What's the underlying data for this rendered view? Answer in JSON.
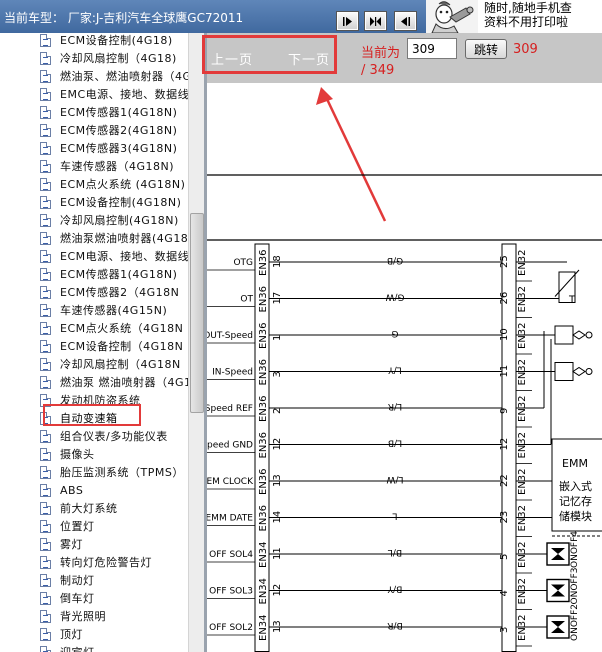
{
  "header": {
    "vehicle_label": "当前车型：  厂家:J-吉利汽车全球鹰GC72011",
    "promo_line1": "随时,随地手机查",
    "promo_line2": "资料不用打印啦"
  },
  "sidebar": {
    "items": [
      {
        "label": "ECM设备控制(4G18)",
        "selected": false
      },
      {
        "label": "冷却风扇控制（4G18)",
        "selected": false
      },
      {
        "label": "燃油泵、燃油喷射器（4G",
        "selected": false
      },
      {
        "label": "EMC电源、接地、数据线",
        "selected": false
      },
      {
        "label": "ECM传感器1(4G18N)",
        "selected": false
      },
      {
        "label": "ECM传感器2(4G18N)",
        "selected": false
      },
      {
        "label": "ECM传感器3(4G18N)",
        "selected": false
      },
      {
        "label": "车速传感器（4G18N)",
        "selected": false
      },
      {
        "label": "ECM点火系统 (4G18N)",
        "selected": false
      },
      {
        "label": "ECM设备控制(4G18N)",
        "selected": false
      },
      {
        "label": "冷却风扇控制(4G18N)",
        "selected": false
      },
      {
        "label": "燃油泵燃油喷射器(4G18N",
        "selected": false
      },
      {
        "label": "ECM电源、接地、数据线",
        "selected": false
      },
      {
        "label": "ECM传感器1(4G18N)",
        "selected": false
      },
      {
        "label": "ECM传感器2（4G18N",
        "selected": false
      },
      {
        "label": "车速传感器(4G15N)",
        "selected": false
      },
      {
        "label": "ECM点火系统（4G18N",
        "selected": false
      },
      {
        "label": "ECM设备控制（4G18N",
        "selected": false
      },
      {
        "label": "冷却风扇控制（4G18N",
        "selected": false
      },
      {
        "label": "燃油泵 燃油喷射器（4G1",
        "selected": false
      },
      {
        "label": "发动机防盗系统",
        "selected": false
      },
      {
        "label": "自动变速箱",
        "selected": true
      },
      {
        "label": "组合仪表/多功能仪表",
        "selected": false
      },
      {
        "label": "摄像头",
        "selected": false
      },
      {
        "label": "胎压监测系统（TPMS）",
        "selected": false
      },
      {
        "label": "ABS",
        "selected": false
      },
      {
        "label": "前大灯系统",
        "selected": false
      },
      {
        "label": "位置灯",
        "selected": false
      },
      {
        "label": "雾灯",
        "selected": false
      },
      {
        "label": "转向灯危险警告灯",
        "selected": false
      },
      {
        "label": "制动灯",
        "selected": false
      },
      {
        "label": "倒车灯",
        "selected": false
      },
      {
        "label": "背光照明",
        "selected": false
      },
      {
        "label": "顶灯",
        "selected": false
      },
      {
        "label": "迎宾灯",
        "selected": false
      }
    ]
  },
  "pager": {
    "prev_label": "上一页",
    "next_label": "下一页",
    "current_label": "当前为",
    "page_value": "309",
    "jump_label": "跳转",
    "page_current": "309",
    "page_total": "/ 349"
  },
  "diagram": {
    "rows": [
      {
        "pin_name": "OTG",
        "left_conn": "EN36",
        "left_pin": "18",
        "wire": "G/B",
        "right_pin": "25",
        "right_conn": "EN32"
      },
      {
        "pin_name": "OT",
        "left_conn": "EN36",
        "left_pin": "17",
        "wire": "G/W",
        "right_pin": "26",
        "right_conn": "EN32"
      },
      {
        "pin_name": "OUT-Speed",
        "left_conn": "EN36",
        "left_pin": "1",
        "wire": "G",
        "right_pin": "10",
        "right_conn": "EN32"
      },
      {
        "pin_name": "IN-Speed",
        "left_conn": "EN36",
        "left_pin": "3",
        "wire": "L/Y",
        "right_pin": "11",
        "right_conn": "EN32"
      },
      {
        "pin_name": "Speed REF",
        "left_conn": "EN36",
        "left_pin": "2",
        "wire": "L/R",
        "right_pin": "9",
        "right_conn": "EN32"
      },
      {
        "pin_name": "Speed GND",
        "left_conn": "EN36",
        "left_pin": "12",
        "wire": "L/B",
        "right_pin": "12",
        "right_conn": "EN32"
      },
      {
        "pin_name": "EM CLOCK",
        "left_conn": "EN36",
        "left_pin": "13",
        "wire": "L/W",
        "right_pin": "22",
        "right_conn": "EN32"
      },
      {
        "pin_name": "EMM DATE",
        "left_conn": "EN36",
        "left_pin": "14",
        "wire": "L",
        "right_pin": "23",
        "right_conn": "EN32"
      },
      {
        "pin_name": "OFF SOL4",
        "left_conn": "EN34",
        "left_pin": "11",
        "wire": "B/L",
        "right_pin": "5",
        "right_conn": "EN32"
      },
      {
        "pin_name": "OFF SOL3",
        "left_conn": "EN34",
        "left_pin": "12",
        "wire": "B/Y",
        "right_pin": "4",
        "right_conn": "EN32"
      },
      {
        "pin_name": "OFF SOL2",
        "left_conn": "EN34",
        "left_pin": "13",
        "wire": "B/R",
        "right_pin": "3",
        "right_conn": "EN32"
      }
    ],
    "sensor_label": "T",
    "emm_title": "EMM",
    "emm_desc_1": "嵌入式",
    "emm_desc_2": "记忆存",
    "emm_desc_3": "储模块",
    "sol_labels": [
      "ONOFF4",
      "ONOFF3",
      "ONOFF2"
    ]
  },
  "colors": {
    "header_bg": "#4e76ab",
    "highlight_red": "#e23a3a",
    "page_red": "#d62020",
    "pager_bg": "#c6c6c6"
  }
}
